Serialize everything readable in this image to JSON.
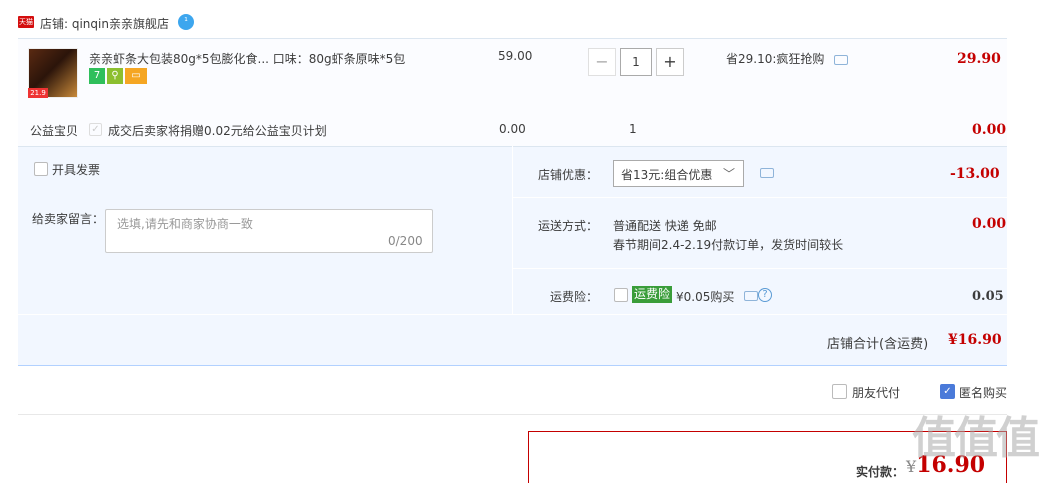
{
  "store": {
    "badge": "天猫",
    "label": "店铺: qinqin亲亲旗舰店"
  },
  "item": {
    "title": "亲亲虾条大包装80g*5包膨化食... 口味：80g虾条原味*5包",
    "unit_price": "59.00",
    "quantity": "1",
    "discount_tip": "省29.10:疯狂抢购",
    "total": "29.90",
    "thumb_tag": "21.9",
    "service_icons": [
      "seven-day-return-icon",
      "delivery-guarantee-icon",
      "credit-card-icon"
    ]
  },
  "charity": {
    "label": "公益宝贝",
    "text": "成交后卖家将捐赠0.02元给公益宝贝计划",
    "price": "0.00",
    "quantity": "1",
    "total": "0.00"
  },
  "invoice": {
    "label": "开具发票"
  },
  "message": {
    "label": "给卖家留言：",
    "placeholder": "选填,请先和商家协商一致",
    "count": "0/200"
  },
  "store_discount": {
    "label": "店铺优惠：",
    "selected": "省13元:组合优惠",
    "value": "-13.00"
  },
  "shipping": {
    "label": "运送方式：",
    "line1": "普通配送 快递 免邮",
    "line2": "春节期间2.4-2.19付款订单，发货时间较长",
    "value": "0.00"
  },
  "insurance": {
    "label": "运费险：",
    "badge": "运费险",
    "text": "¥0.05购买",
    "value": "0.05"
  },
  "store_total": {
    "label": "店铺合计(含运费)",
    "value": "¥16.90"
  },
  "options": {
    "friend_pay": "朋友代付",
    "anonymous": "匿名购买"
  },
  "payment": {
    "label": "实付款：",
    "yen": "¥",
    "value": "16.90"
  },
  "watermark": "值值值",
  "colors": {
    "price_red": "#c40000",
    "panel_blue": "#f2f7ff",
    "checkbox_blue": "#4a7ad9",
    "insurance_green": "#3a9d3a"
  }
}
